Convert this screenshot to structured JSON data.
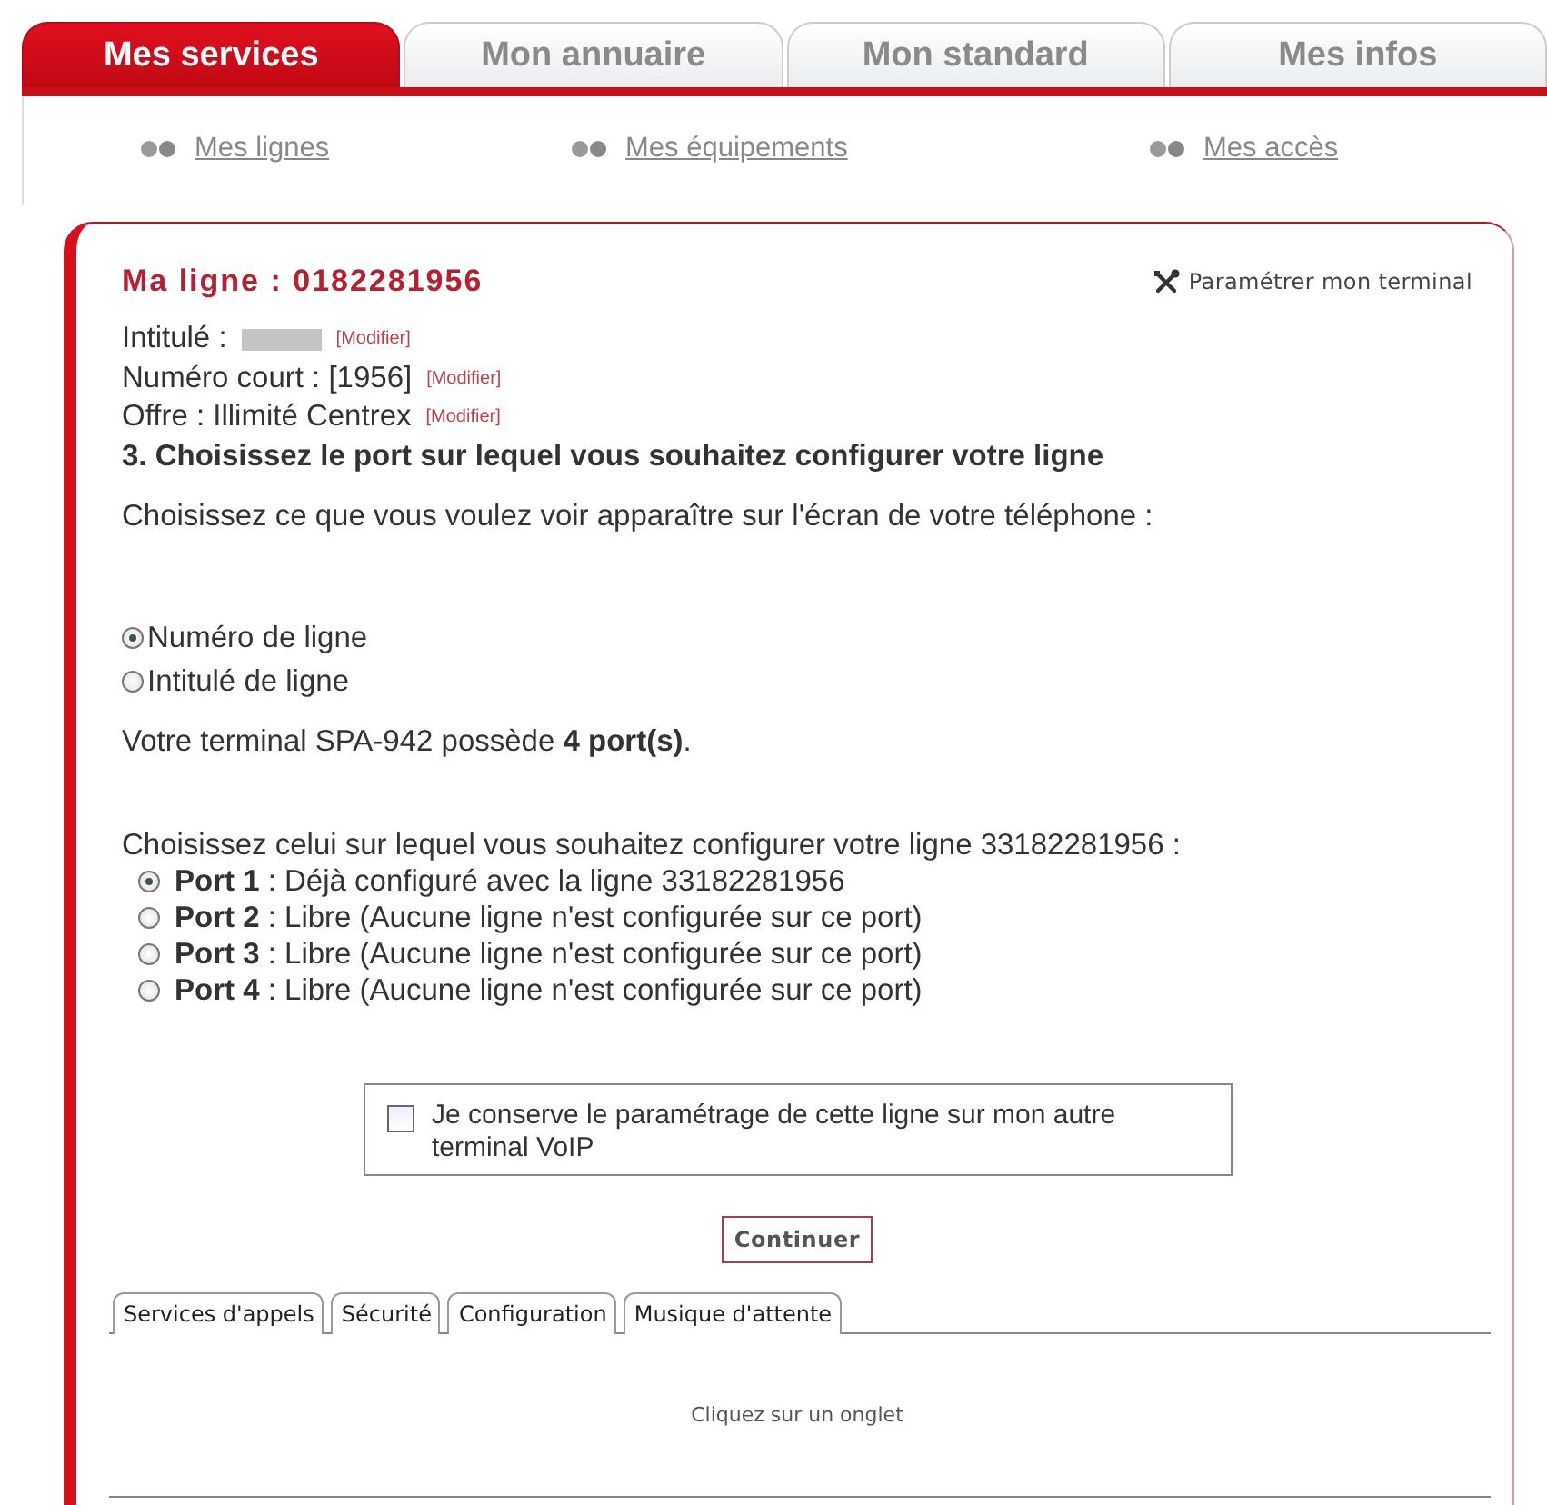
{
  "main_tabs": [
    {
      "label": "Mes services",
      "selected": true
    },
    {
      "label": "Mon annuaire",
      "selected": false
    },
    {
      "label": "Mon standard",
      "selected": false
    },
    {
      "label": "Mes infos",
      "selected": false
    }
  ],
  "sub_links": [
    {
      "label": "Mes lignes"
    },
    {
      "label": "Mes équipements"
    },
    {
      "label": "Mes accès"
    }
  ],
  "line_card": {
    "title": "Ma ligne : 0182281956",
    "settings_link": "Paramétrer mon terminal",
    "fields": [
      {
        "label": "Intitulé :",
        "value_redacted": true,
        "action": "[Modifier]"
      },
      {
        "label": "Numéro court : [1956]",
        "value_redacted": false,
        "action": "[Modifier]"
      },
      {
        "label": "Offre : Illimité Centrex",
        "value_redacted": false,
        "action": "[Modifier]"
      }
    ],
    "step_title": "3. Choisissez le port sur lequel vous souhaitez configurer votre ligne",
    "display_prompt": "Choisissez ce que vous voulez voir apparaître sur l'écran de votre téléphone :",
    "display_options": [
      {
        "label": "Numéro de ligne",
        "selected": true
      },
      {
        "label": "Intitulé de ligne",
        "selected": false
      }
    ],
    "terminal_info": "Votre terminal SPA-942 possède **4 port(s)**.",
    "port_prompt": "Choisissez celui sur lequel vous souhaitez configurer votre ligne 33182281956 :",
    "ports": [
      {
        "label": "**Port 1** : Déjà configuré avec la ligne 33182281956",
        "selected": true
      },
      {
        "label": "**Port 2** : Libre (Aucune ligne n'est configurée sur ce port)",
        "selected": false
      },
      {
        "label": "**Port 3** : Libre (Aucune ligne n'est configurée sur ce port)",
        "selected": false
      },
      {
        "label": "**Port 4** : Libre (Aucune ligne n'est configurée sur ce port)",
        "selected": false
      }
    ],
    "keep_checkbox": {
      "label": "Je conserve le paramétrage de cette ligne sur mon autre terminal VoIP",
      "checked": false
    },
    "continue_button": "Continuer",
    "sub_tabs": [
      {
        "label": "Services d'appels",
        "selected": false
      },
      {
        "label": "Sécurité",
        "selected": false
      },
      {
        "label": "Configuration",
        "selected": false
      },
      {
        "label": "Musique d'attente",
        "selected": false
      }
    ],
    "tab_hint": "Cliquez sur un onglet"
  }
}
